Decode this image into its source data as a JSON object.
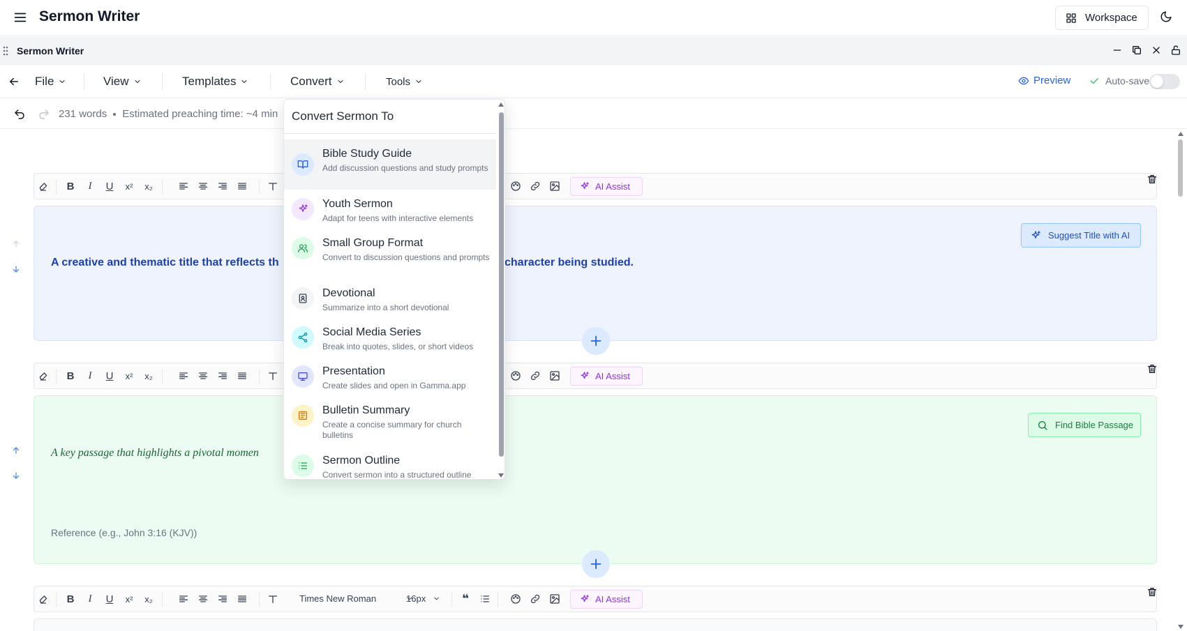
{
  "app": {
    "title": "Sermon Writer",
    "workspace_label": "Workspace"
  },
  "window": {
    "title": "Sermon Writer"
  },
  "menubar": {
    "items": [
      "File",
      "View",
      "Templates",
      "Convert",
      "Tools"
    ],
    "preview_label": "Preview",
    "autosave_label": "Auto-save",
    "autosave_on": false
  },
  "status": {
    "words": "231 words",
    "preaching_time": "Estimated preaching time: ~4 min"
  },
  "toolbar": {
    "font_family": "Times New Roman",
    "font_size": "16px",
    "ai_assist_label": "AI Assist"
  },
  "sections": {
    "title": {
      "placeholder_left": "A creative and thematic title that reflects th",
      "placeholder_right": "character being studied.",
      "suggest_label": "Suggest Title with AI"
    },
    "passage": {
      "placeholder": "A key passage that highlights a pivotal momen",
      "reference_placeholder": "Reference (e.g., John 3:16 (KJV))",
      "find_label": "Find Bible Passage"
    }
  },
  "convert_menu": {
    "title": "Convert Sermon To",
    "items": [
      {
        "label": "Bible Study Guide",
        "description": "Add discussion questions and study prompts",
        "icon": "book-open-icon",
        "color": "#2563eb",
        "bg": "#dbeafe"
      },
      {
        "label": "Youth Sermon",
        "description": "Adapt for teens with interactive elements",
        "icon": "sparkles-icon",
        "color": "#9333ea",
        "bg": "#f3e8ff"
      },
      {
        "label": "Small Group Format",
        "description": "Convert to discussion questions and prompts",
        "icon": "users-icon",
        "color": "#16a34a",
        "bg": "#dcfce7"
      },
      {
        "label": "Devotional",
        "description": "Summarize into a short devotional",
        "icon": "book-icon",
        "color": "#374151",
        "bg": "#f3f4f6"
      },
      {
        "label": "Social Media Series",
        "description": "Break into quotes, slides, or short videos",
        "icon": "share-icon",
        "color": "#0891b2",
        "bg": "#cffafe"
      },
      {
        "label": "Presentation",
        "description": "Create slides and open in Gamma.app",
        "icon": "presentation-icon",
        "color": "#4f46e5",
        "bg": "#e0e7ff"
      },
      {
        "label": "Bulletin Summary",
        "description": "Create a concise summary for church bulletins",
        "icon": "newspaper-icon",
        "color": "#d97706",
        "bg": "#fef3c7"
      },
      {
        "label": "Sermon Outline",
        "description": "Convert sermon into a structured outline",
        "icon": "list-icon",
        "color": "#16a34a",
        "bg": "#dcfce7"
      }
    ]
  }
}
